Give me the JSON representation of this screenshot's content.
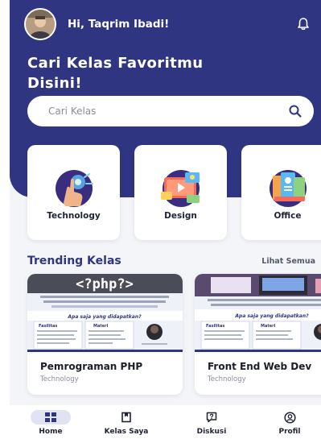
{
  "header": {
    "greeting": "Hi, Taqrim Ibadi!",
    "headline": "Cari Kelas Favoritmu Disini!"
  },
  "search": {
    "placeholder": "Cari Kelas"
  },
  "categories": [
    {
      "label": "Technology"
    },
    {
      "label": "Design"
    },
    {
      "label": "Office"
    }
  ],
  "trending": {
    "title": "Trending Kelas",
    "see_all": "Lihat Semua",
    "courses": [
      {
        "title": "Pemrograman PHP",
        "category": "Technology",
        "thumb_heading": "<?php?>"
      },
      {
        "title": "Front End Web Dev",
        "category": "Technology"
      }
    ],
    "thumb_common": {
      "banner": "Apa saja yang didapatkan?",
      "col1": "Fasilitas",
      "col2": "Materi"
    }
  },
  "nav": [
    {
      "label": "Home",
      "active": true
    },
    {
      "label": "Kelas Saya",
      "active": false
    },
    {
      "label": "Diskusi",
      "active": false
    },
    {
      "label": "Profil",
      "active": false
    }
  ],
  "colors": {
    "primary": "#2f3580",
    "accent_blue": "#3d7bf2",
    "background": "#f4f5f9"
  },
  "icons": {
    "bell": "bell-icon",
    "search": "search-icon",
    "home": "home-icon",
    "kelas_saya": "bookmark-icon",
    "diskusi": "chat-question-icon",
    "profil": "profile-icon"
  }
}
